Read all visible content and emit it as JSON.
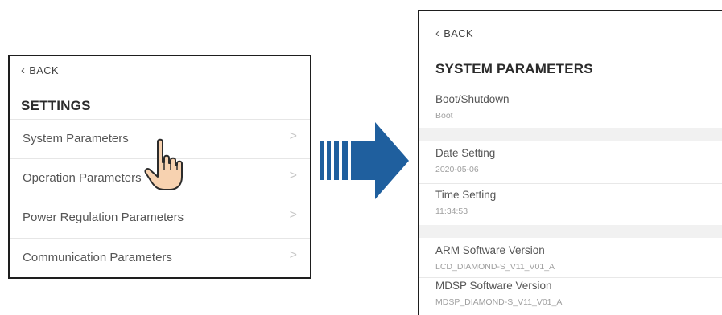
{
  "settings_screen": {
    "back_label": "BACK",
    "title": "SETTINGS",
    "items": [
      {
        "label": "System Parameters"
      },
      {
        "label": "Operation Parameters"
      },
      {
        "label": "Power Regulation Parameters"
      },
      {
        "label": "Communication Parameters"
      }
    ],
    "item_chevron": ">"
  },
  "system_parameters_screen": {
    "back_label": "BACK",
    "title": "SYSTEM PARAMETERS",
    "params": [
      {
        "name": "Boot/Shutdown",
        "value": "Boot"
      },
      {
        "name": "Date Setting",
        "value": "2020-05-06"
      },
      {
        "name": "Time Setting",
        "value": "11:34:53"
      },
      {
        "name": "ARM Software Version",
        "value": "LCD_DIAMOND-S_V11_V01_A"
      },
      {
        "name": "MDSP Software Version",
        "value": "MDSP_DIAMOND-S_V11_V01_A"
      }
    ]
  },
  "colors": {
    "transition_arrow": "#1f5f9e",
    "hand_skin": "#f7d2b0"
  },
  "icons": {
    "pointer": "hand-pointer-icon",
    "transition": "right-arrow-icon",
    "back": "chevron-left-icon"
  }
}
